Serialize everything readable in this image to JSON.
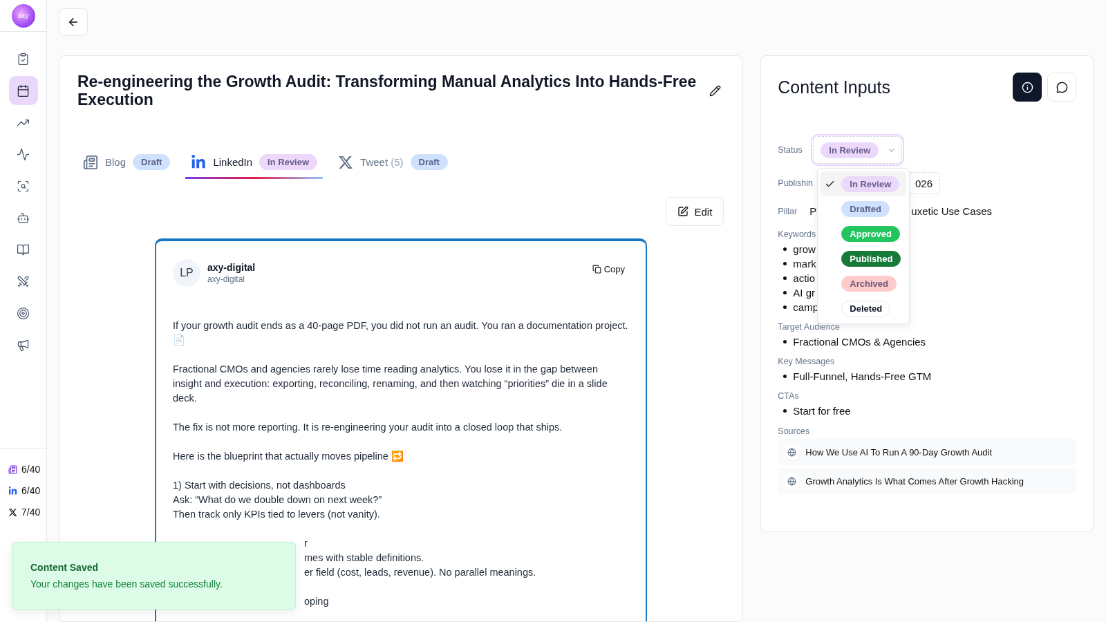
{
  "sidebar": {
    "logo": "axy",
    "items": [
      {
        "selected": false
      },
      {
        "selected": true
      },
      {
        "selected": false
      },
      {
        "selected": false
      },
      {
        "selected": false
      },
      {
        "selected": false
      },
      {
        "selected": false
      },
      {
        "selected": false
      },
      {
        "selected": false
      },
      {
        "selected": false
      }
    ],
    "counts": [
      {
        "kind": "blog",
        "text": "6/40"
      },
      {
        "kind": "linkedin",
        "text": "6/40"
      },
      {
        "kind": "x",
        "text": "7/40"
      }
    ]
  },
  "content": {
    "title": "Re-engineering the Growth Audit: Transforming Manual Analytics Into Hands-Free Execution",
    "tabs": [
      {
        "kind": "blog",
        "label": "Blog",
        "badge": {
          "text": "Draft",
          "color": "#cfe1fd"
        },
        "selected": false
      },
      {
        "kind": "linkedin",
        "label": "LinkedIn",
        "badge": {
          "text": "In Review",
          "color": "#ecd8fb"
        },
        "selected": true
      },
      {
        "kind": "x",
        "label": "Tweet",
        "count": "(5)",
        "badge": {
          "text": "Draft",
          "color": "#cfe1fd"
        },
        "selected": false
      }
    ],
    "edit_button": "Edit",
    "post": {
      "avatar": "LP",
      "name": "axy-digital",
      "handle": "axy-digital",
      "copy_button": "Copy",
      "blocks": [
        {
          "kind": "full",
          "lines": [
            "If your growth audit ends as a 40-page PDF, you did not run an audit. You ran a documentation project. 📄"
          ]
        },
        {
          "kind": "full",
          "lines": [
            "Fractional CMOs and agencies rarely lose time reading analytics. You lose it in the gap between insight and execution: exporting, reconciling, renaming, and then watching “priorities” die in a slide deck."
          ]
        },
        {
          "kind": "full",
          "lines": [
            "The fix is not more reporting. It is re-engineering your audit into a closed loop that ships."
          ]
        },
        {
          "kind": "full",
          "lines": [
            "Here is the blueprint that actually moves pipeline 🔁"
          ]
        },
        {
          "kind": "full",
          "lines": [
            "1) Start with decisions, not dashboards",
            "Ask: “What do we double down on next week?”",
            "Then track only KPIs tied to levers (not vanity)."
          ]
        },
        {
          "kind": "cut",
          "lines": [
            "r",
            "mes with stable definitions.",
            "er field (cost, leads, revenue). No parallel meanings."
          ]
        },
        {
          "kind": "cut",
          "lines": [
            "oping"
          ]
        }
      ]
    }
  },
  "inputs": {
    "title": "Content Inputs",
    "status": {
      "label": "Status",
      "value": {
        "text": "In Review",
        "color": "#ecd8fb"
      },
      "expanded": true,
      "options": [
        {
          "text": "In Review",
          "color": "#ecd8fb",
          "selected": true
        },
        {
          "text": "Drafted",
          "color": "#cfe1fd",
          "selected": false
        },
        {
          "text": "Approved",
          "color": "#22c55e",
          "selected": false
        },
        {
          "text": "Published",
          "color": "#177a3a",
          "selected": false
        },
        {
          "text": "Archived",
          "color": "#fecaca",
          "selected": false
        },
        {
          "text": "Deleted",
          "color": "#ffffff",
          "selected": false
        }
      ]
    },
    "publishing": {
      "label": "Publishin",
      "value": "026"
    },
    "pillar": {
      "label": "Pillar",
      "value_start": "P",
      "value_end": "uxetic Use Cases"
    },
    "lists": [
      {
        "label": "Keywords",
        "items": [
          "grow",
          "mark",
          "actio",
          "AI gr",
          "camp"
        ]
      },
      {
        "label": "Target Audience",
        "items": [
          "Fractional CMOs & Agencies"
        ]
      },
      {
        "label": "Key Messages",
        "items": [
          "Full-Funnel, Hands-Free GTM"
        ]
      },
      {
        "label": "CTAs",
        "items": [
          "Start for free"
        ]
      }
    ],
    "sources": {
      "label": "Sources",
      "items": [
        "How We Use AI To Run A 90-Day Growth Audit",
        "Growth Analytics Is What Comes After Growth Hacking"
      ]
    }
  },
  "toast": {
    "title": "Content Saved",
    "message": "Your changes have been saved successfully."
  }
}
